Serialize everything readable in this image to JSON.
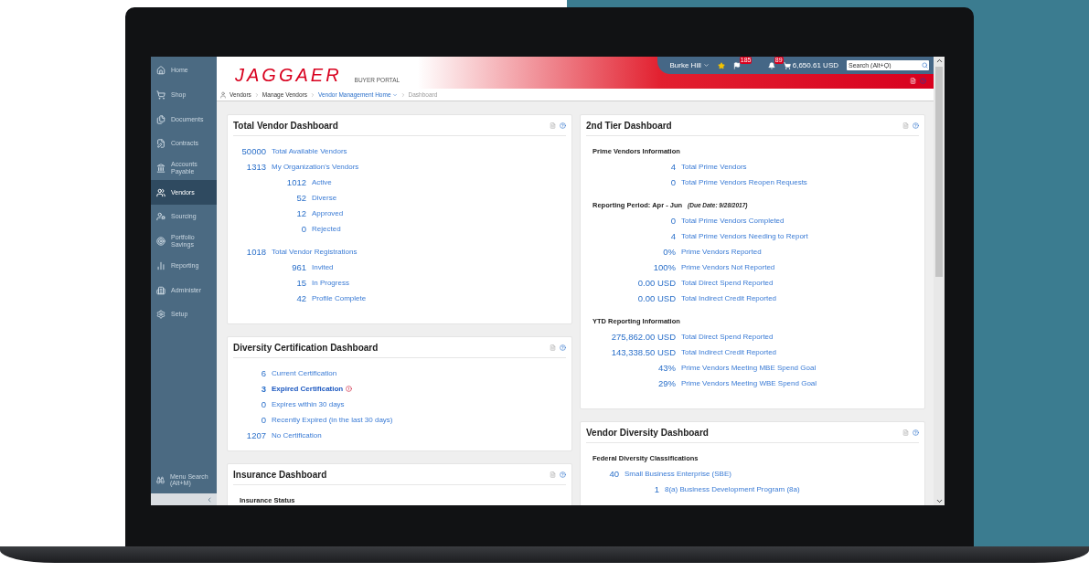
{
  "sidebar": {
    "items": [
      {
        "label": "Home",
        "selected": false
      },
      {
        "label": "Shop",
        "selected": false
      },
      {
        "label": "Documents",
        "selected": false
      },
      {
        "label": "Contracts",
        "selected": false
      },
      {
        "label": "Accounts Payable",
        "selected": false
      },
      {
        "label": "Vendors",
        "selected": true
      },
      {
        "label": "Sourcing",
        "selected": false
      },
      {
        "label": "Portfolio Savings",
        "selected": false
      },
      {
        "label": "Reporting",
        "selected": false
      },
      {
        "label": "Administer",
        "selected": false
      },
      {
        "label": "Setup",
        "selected": false
      }
    ],
    "menu_search": {
      "label": "Menu Search",
      "shortcut": "(Alt+M)"
    }
  },
  "header": {
    "logo": "JAGGAER",
    "portal": "BUYER PORTAL",
    "user": "Burke Hill",
    "flag_count": "185",
    "notification_count": "89",
    "cart_total": "6,650.61 USD",
    "search": {
      "placeholder": "Search (Alt+Q)"
    }
  },
  "breadcrumb": [
    {
      "label": "Vendors",
      "kind": "plain"
    },
    {
      "label": "Manage Vendors",
      "kind": "plain"
    },
    {
      "label": "Vendor Management Home",
      "kind": "menu"
    },
    {
      "label": "Dashboard",
      "kind": "current"
    }
  ],
  "left_panels": [
    {
      "title": "Total Vendor Dashboard",
      "sections": [
        {
          "rows": [
            {
              "value": "50000",
              "label": "Total Available Vendors",
              "flagged": false
            },
            {
              "value": "1313",
              "label": "My Organization's Vendors",
              "flagged": false,
              "children": [
                {
                  "value": "1012",
                  "label": "Active",
                  "flagged": false
                },
                {
                  "value": "52",
                  "label": "Diverse",
                  "flagged": false
                },
                {
                  "value": "12",
                  "label": "Approved",
                  "flagged": false
                },
                {
                  "value": "0",
                  "label": "Rejected",
                  "flagged": false
                }
              ]
            }
          ]
        },
        {
          "rows": [
            {
              "value": "1018",
              "label": "Total Vendor Registrations",
              "flagged": false,
              "children": [
                {
                  "value": "961",
                  "label": "Invited",
                  "flagged": false
                },
                {
                  "value": "15",
                  "label": "In Progress",
                  "flagged": false
                },
                {
                  "value": "42",
                  "label": "Profile Complete",
                  "flagged": false
                }
              ]
            }
          ]
        }
      ]
    },
    {
      "title": "Diversity Certification Dashboard",
      "sections": [
        {
          "rows": [
            {
              "value": "6",
              "label": "Current Certification",
              "flagged": false
            },
            {
              "value": "3",
              "label": "Expired Certification",
              "flagged": true
            },
            {
              "value": "0",
              "label": "Expires within 30 days",
              "flagged": false
            },
            {
              "value": "0",
              "label": "Recently Expired (in the last 30 days)",
              "flagged": false
            },
            {
              "value": "1207",
              "label": "No Certification",
              "flagged": false
            }
          ]
        }
      ]
    },
    {
      "title": "Insurance Dashboard",
      "sections": [
        {
          "heading": "Insurance Status"
        }
      ]
    }
  ],
  "right_panels": [
    {
      "title": "2nd Tier Dashboard",
      "sections": [
        {
          "heading": "Prime Vendors Information",
          "rows": [
            {
              "value": "4",
              "label": "Total Prime Vendors",
              "flagged": false
            },
            {
              "value": "0",
              "label": "Total Prime Vendors Reopen Requests",
              "flagged": false
            }
          ]
        },
        {
          "heading": "Reporting Period: Apr - Jun",
          "note": "(Due Date: 9/28/2017)",
          "rows": [
            {
              "value": "0",
              "label": "Total Prime Vendors Completed",
              "flagged": false
            },
            {
              "value": "4",
              "label": "Total Prime Vendors Needing to Report",
              "flagged": false
            },
            {
              "value": "0%",
              "label": "Prime Vendors Reported",
              "flagged": false
            },
            {
              "value": "100%",
              "label": "Prime Vendors Not Reported",
              "flagged": false
            },
            {
              "value": "0.00 USD",
              "label": "Total Direct Spend Reported",
              "flagged": false
            },
            {
              "value": "0.00 USD",
              "label": "Total Indirect Credit Reported",
              "flagged": false
            }
          ]
        },
        {
          "heading": "YTD Reporting Information",
          "rows": [
            {
              "value": "275,862.00 USD",
              "label": "Total Direct Spend Reported",
              "flagged": false
            },
            {
              "value": "143,338.50 USD",
              "label": "Total Indirect Credit Reported",
              "flagged": false
            },
            {
              "value": "43%",
              "label": "Prime Vendors Meeting MBE Spend Goal",
              "flagged": false
            },
            {
              "value": "29%",
              "label": "Prime Vendors Meeting WBE Spend Goal",
              "flagged": false
            }
          ]
        }
      ]
    },
    {
      "title": "Vendor Diversity Dashboard",
      "sections": [
        {
          "heading": "Federal Diversity Classifications",
          "rows": [
            {
              "value": "40",
              "label": "Small Business Enterprise (SBE)",
              "flagged": false,
              "children": [
                {
                  "value": "1",
                  "label": "8(a) Business Development Program (8a)",
                  "flagged": false
                }
              ]
            }
          ]
        }
      ]
    }
  ]
}
